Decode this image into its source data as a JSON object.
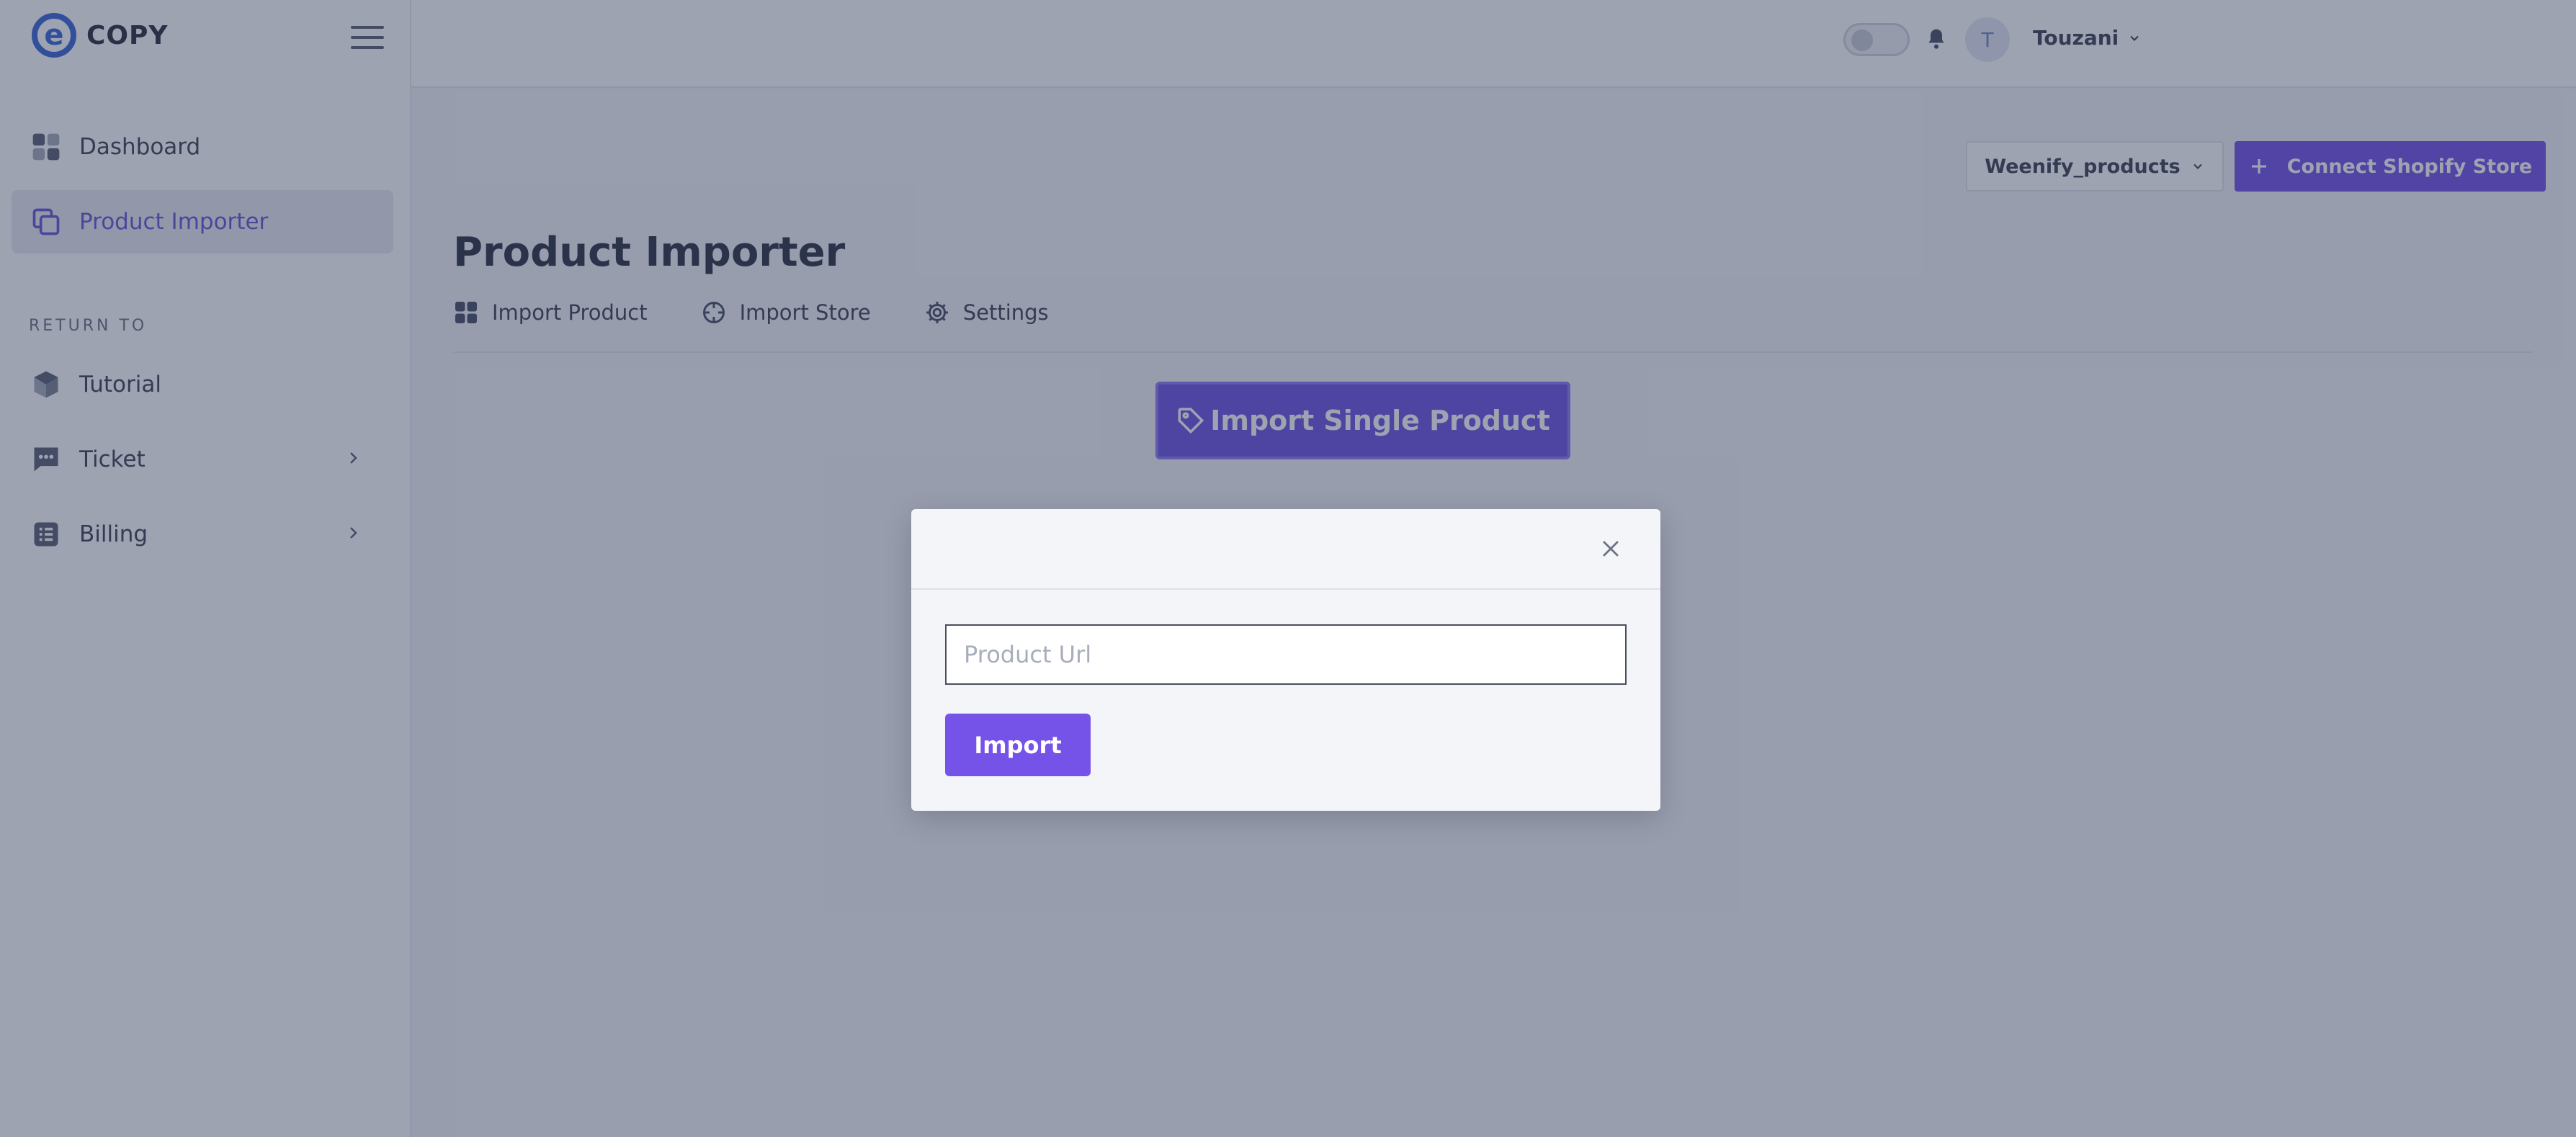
{
  "brand": {
    "logo_letter": "e",
    "name": "COPY"
  },
  "sidebar": {
    "items": [
      {
        "label": "Dashboard",
        "icon": "dashboard-grid-icon"
      },
      {
        "label": "Product Importer",
        "icon": "copy-icon",
        "active": true
      }
    ],
    "section_label": "RETURN TO",
    "return_items": [
      {
        "label": "Tutorial",
        "icon": "box-icon"
      },
      {
        "label": "Ticket",
        "icon": "message-icon",
        "has_submenu": true
      },
      {
        "label": "Billing",
        "icon": "list-icon",
        "has_submenu": true
      }
    ]
  },
  "topbar": {
    "avatar_initial": "T",
    "username": "Touzani"
  },
  "toolbar": {
    "store_selected": "Weenify_products",
    "connect_label": "Connect Shopify Store"
  },
  "page": {
    "title": "Product Importer",
    "tabs": [
      {
        "label": "Import Product",
        "icon": "grid-icon"
      },
      {
        "label": "Import Store",
        "icon": "crosshair-icon"
      },
      {
        "label": "Settings",
        "icon": "gear-icon"
      }
    ],
    "single_button_label": "Import Single Product"
  },
  "modal": {
    "input_placeholder": "Product Url",
    "input_value": "",
    "import_label": "Import"
  },
  "colors": {
    "accent": "#7653e8",
    "overlay": "#283452"
  }
}
